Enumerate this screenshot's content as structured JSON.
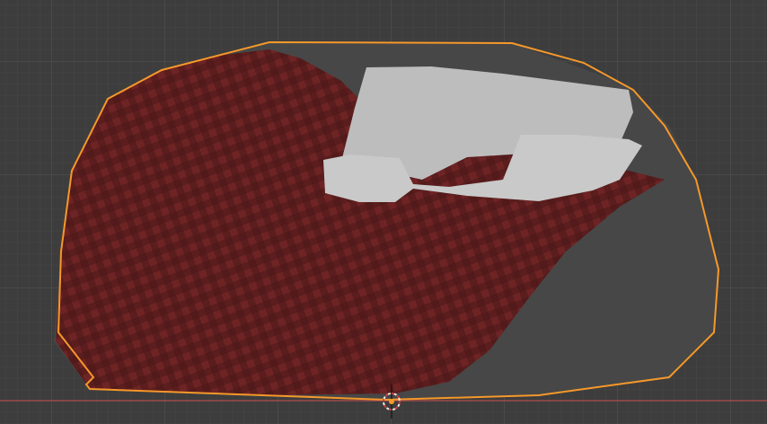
{
  "viewport": {
    "background": "#3d3d3d",
    "grid_minor_color": "#454545",
    "grid_major_color": "#4d4d4d",
    "x_axis_color": "#9b4a4a",
    "selection_outline_color": "#f5982a"
  },
  "objects": [
    {
      "name": "mattress",
      "color": "#474747"
    },
    {
      "name": "blanket",
      "color": "#6e2424",
      "check_color": "#4a1818"
    },
    {
      "name": "pillow-back",
      "color": "#bdbdbd"
    },
    {
      "name": "pillow-front",
      "color": "#c7c7c7"
    }
  ],
  "cursor": {
    "ring_red": "#d23c3c",
    "ring_white": "#e8e8e8",
    "origin_color": "#f5982a"
  }
}
